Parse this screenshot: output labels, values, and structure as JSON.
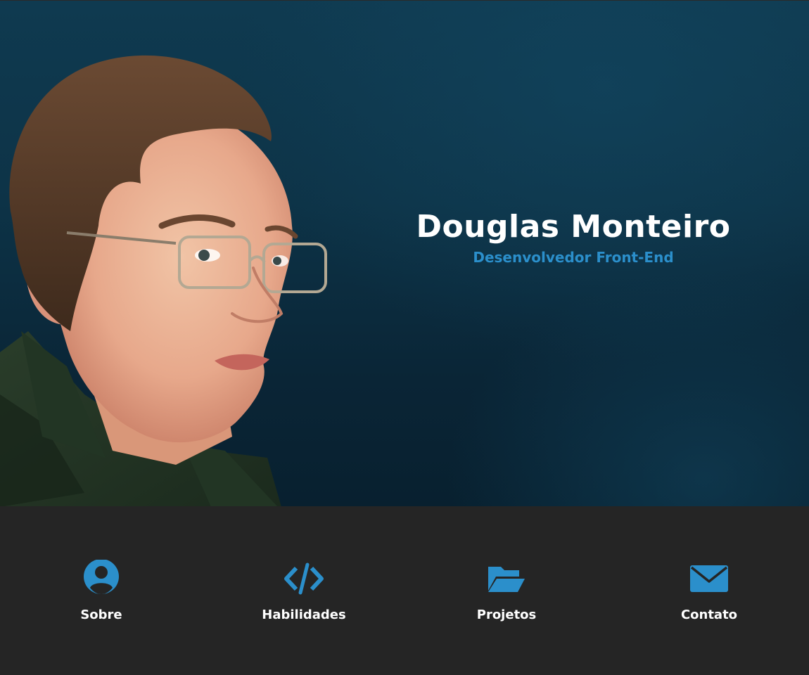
{
  "hero": {
    "name": "Douglas Monteiro",
    "role": "Desenvolvedor Front-End",
    "portrait": "illustrated portrait of a young man with glasses"
  },
  "nav": {
    "items": [
      {
        "label": "Sobre",
        "icon": "user-circle-icon"
      },
      {
        "label": "Habilidades",
        "icon": "code-icon"
      },
      {
        "label": "Projetos",
        "icon": "folder-open-icon"
      },
      {
        "label": "Contato",
        "icon": "envelope-icon"
      }
    ]
  },
  "colors": {
    "accent": "#2b8fcb",
    "hero_bg": "#0d3347",
    "nav_bg": "#252525",
    "text": "#ffffff"
  }
}
